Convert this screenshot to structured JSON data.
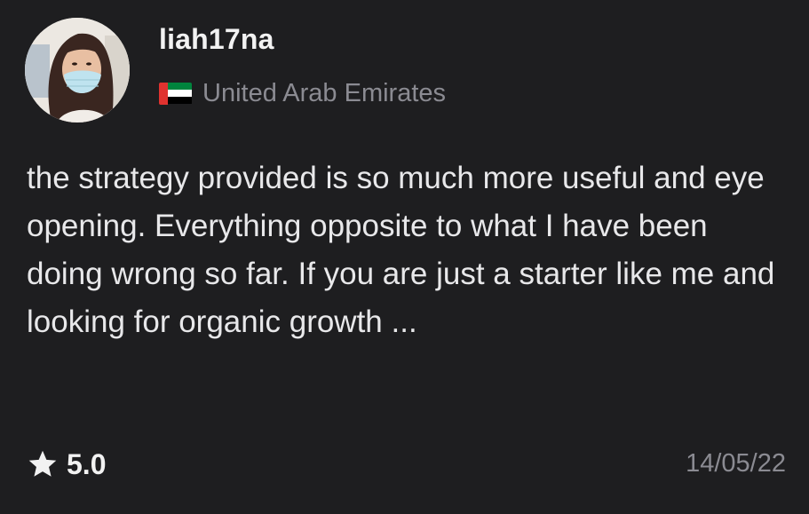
{
  "review": {
    "username": "liah17na",
    "country": "United Arab Emirates",
    "flag_icon": "uae-flag-icon",
    "text": "the strategy provided is so much more useful and eye opening. Everything opposite to what I have been doing wrong so far. If you are just a starter like me and looking for organic growth ...",
    "rating": "5.0",
    "rating_icon": "star-icon",
    "date": "14/05/22"
  },
  "colors": {
    "background": "#1e1e20",
    "primary_text": "#f2f2f2",
    "secondary_text": "#8b8b92",
    "flag_red": "#e0322f",
    "flag_green": "#00843d",
    "flag_white": "#ffffff",
    "flag_black": "#000000"
  }
}
